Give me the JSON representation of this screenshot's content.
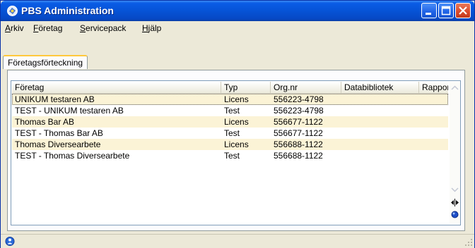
{
  "window": {
    "title": "PBS Administration",
    "colors": {
      "titlebar": "#0653d6",
      "close_button": "#d9492a",
      "row_shade": "#fbf3d6"
    }
  },
  "menu": {
    "items": [
      "Arkiv",
      "Företag",
      "Servicepack",
      "Hjälp"
    ]
  },
  "tabs": [
    {
      "label": "Företagsförteckning",
      "active": true
    }
  ],
  "table": {
    "columns": [
      "Företag",
      "Typ",
      "Org.nr",
      "Databibliotek",
      "Rapportb"
    ],
    "rows": [
      {
        "company": "UNIKUM testaren AB",
        "type": "Licens",
        "org_nr": "556223-4798",
        "library": "",
        "report": ""
      },
      {
        "company": "TEST - UNIKUM testaren AB",
        "type": "Test",
        "org_nr": "556223-4798",
        "library": "",
        "report": ""
      },
      {
        "company": "Thomas Bar AB",
        "type": "Licens",
        "org_nr": "556677-1122",
        "library": "",
        "report": ""
      },
      {
        "company": "TEST - Thomas Bar AB",
        "type": "Test",
        "org_nr": "556677-1122",
        "library": "",
        "report": ""
      },
      {
        "company": "Thomas Diversearbete",
        "type": "Licens",
        "org_nr": "556688-1122",
        "library": "",
        "report": ""
      },
      {
        "company": "TEST - Thomas Diversearbete",
        "type": "Test",
        "org_nr": "556688-1122",
        "library": "",
        "report": ""
      }
    ]
  },
  "icons": {
    "app": "pbs-app-icon",
    "status": "user-status-icon",
    "scroll_horizontal": "horizontal-scroll-icon",
    "scroll_indicator": "scroll-position-icon"
  }
}
